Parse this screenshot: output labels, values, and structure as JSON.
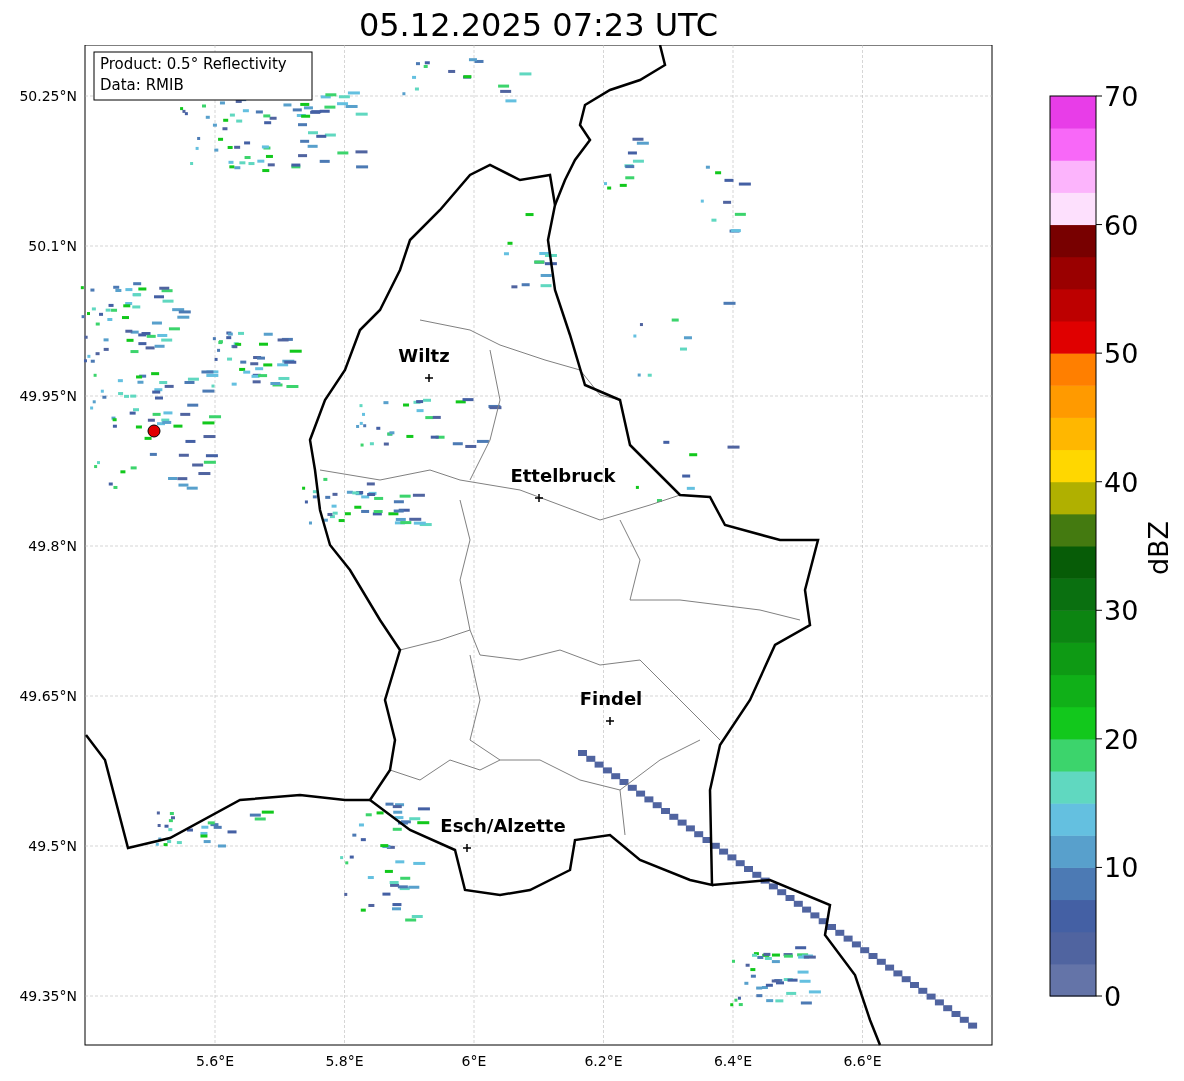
{
  "title": "05.12.2025 07:23 UTC",
  "legend": [
    "Product: 0.5° Reflectivity",
    "Data: RMIB"
  ],
  "map": {
    "lat_ticks": [
      "50.25°N",
      "50.1°N",
      "49.95°N",
      "49.8°N",
      "49.65°N",
      "49.5°N",
      "49.35°N"
    ],
    "lon_ticks": [
      "5.6°E",
      "5.8°E",
      "6°E",
      "6.2°E",
      "6.4°E",
      "6.6°E"
    ],
    "cities": [
      {
        "name": "Wiltz"
      },
      {
        "name": "Ettelbruck"
      },
      {
        "name": "Findel"
      },
      {
        "name": "Esch/Alzette"
      }
    ]
  },
  "colorbar": {
    "label": "dBZ",
    "ticks": [
      "70",
      "60",
      "50",
      "40",
      "30",
      "20",
      "10",
      "0"
    ],
    "bands": [
      {
        "color": "#6474a8"
      },
      {
        "color": "#5064a0"
      },
      {
        "color": "#4460a4"
      },
      {
        "color": "#4c7ab4"
      },
      {
        "color": "#58a0cc"
      },
      {
        "color": "#64c0e0"
      },
      {
        "color": "#60d8c0"
      },
      {
        "color": "#3cd46c"
      },
      {
        "color": "#12c81c"
      },
      {
        "color": "#10b018"
      },
      {
        "color": "#0e9a14"
      },
      {
        "color": "#0c8512"
      },
      {
        "color": "#0a7010"
      },
      {
        "color": "#075c07"
      },
      {
        "color": "#447a10"
      },
      {
        "color": "#b0b000"
      },
      {
        "color": "#ffd700"
      },
      {
        "color": "#ffb700"
      },
      {
        "color": "#ff9a00"
      },
      {
        "color": "#ff7f00"
      },
      {
        "color": "#e00000"
      },
      {
        "color": "#bd0000"
      },
      {
        "color": "#9a0000"
      },
      {
        "color": "#780000"
      },
      {
        "color": "#fde0fd"
      },
      {
        "color": "#fcb4fc"
      },
      {
        "color": "#f868f8"
      },
      {
        "color": "#e83de8"
      }
    ]
  }
}
